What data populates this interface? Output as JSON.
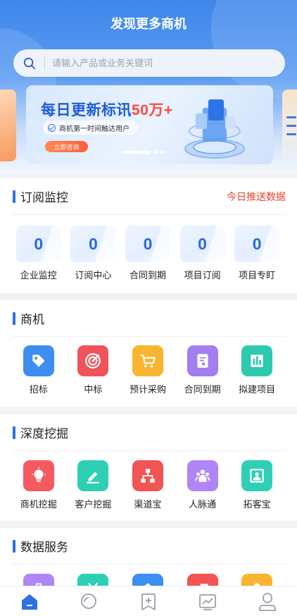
{
  "header": {
    "title": "发现更多商机"
  },
  "search": {
    "placeholder": "请输入产品或业务关键词"
  },
  "banner": {
    "headline_prefix": "每日更新标讯",
    "headline_highlight": "50万+",
    "subtitle": "商机第一时间触达用户",
    "cta": "立即咨询",
    "slide_count": 3,
    "active_slide": 1
  },
  "subscription": {
    "title": "订阅监控",
    "link": "今日推送数据",
    "items": [
      {
        "value": "0",
        "label": "企业监控"
      },
      {
        "value": "0",
        "label": "订阅中心"
      },
      {
        "value": "0",
        "label": "合同到期"
      },
      {
        "value": "0",
        "label": "项目订阅"
      },
      {
        "value": "0",
        "label": "项目专盯"
      }
    ]
  },
  "business": {
    "title": "商机",
    "items": [
      {
        "label": "招标",
        "icon": "tag-icon",
        "color": "#3d8ef0"
      },
      {
        "label": "中标",
        "icon": "target-icon",
        "color": "#f0535a"
      },
      {
        "label": "预计采购",
        "icon": "cart-icon",
        "color": "#f9b52f"
      },
      {
        "label": "合同到期",
        "icon": "contract-icon",
        "color": "#a27ef0"
      },
      {
        "label": "拟建项目",
        "icon": "project-icon",
        "color": "#2fc9b0"
      }
    ]
  },
  "mining": {
    "title": "深度挖掘",
    "items": [
      {
        "label": "商机挖掘",
        "icon": "lightbulb-icon",
        "color": "#f55a61"
      },
      {
        "label": "客户挖掘",
        "icon": "pen-icon",
        "color": "#2fcfb5"
      },
      {
        "label": "渠道宝",
        "icon": "org-chart-icon",
        "color": "#f05453"
      },
      {
        "label": "人脉通",
        "icon": "people-icon",
        "color": "#b085f5"
      },
      {
        "label": "拓客宝",
        "icon": "portrait-icon",
        "color": "#2fcfb5"
      }
    ]
  },
  "data_service": {
    "title": "数据服务",
    "items": [
      {
        "icon": "briefcase-icon",
        "color": "#b085f5"
      },
      {
        "icon": "scissors-icon",
        "color": "#2fcfb5"
      },
      {
        "icon": "home-icon",
        "color": "#3d8ef0"
      },
      {
        "icon": "music-icon",
        "color": "#f05453"
      },
      {
        "icon": "person-icon",
        "color": "#f9b52f"
      }
    ]
  },
  "tabbar": {
    "active_index": 0,
    "tabs": [
      {
        "icon": "home-tab-icon"
      },
      {
        "icon": "search-tab-icon"
      },
      {
        "icon": "add-tab-icon"
      },
      {
        "icon": "chart-tab-icon"
      },
      {
        "icon": "user-tab-icon"
      }
    ]
  }
}
